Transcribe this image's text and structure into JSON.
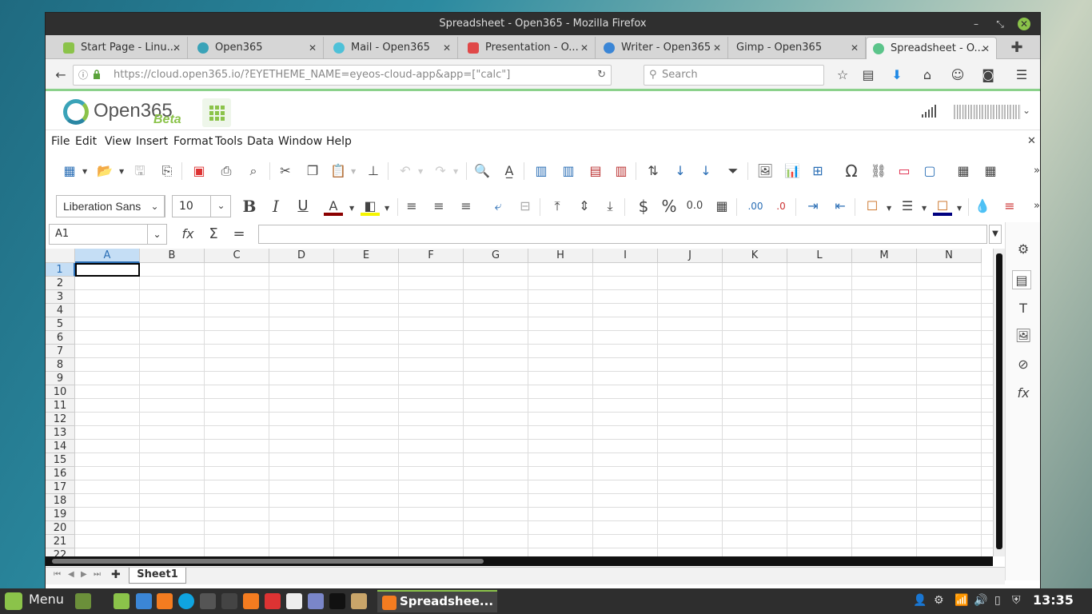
{
  "window": {
    "title": "Spreadsheet - Open365 - Mozilla Firefox",
    "controls": [
      "minimize-icon",
      "restore-icon",
      "close-icon"
    ]
  },
  "tabs": [
    {
      "label": "Start Page - Linu...",
      "favicon_color": "#8bc34a",
      "active": false
    },
    {
      "label": "Open365",
      "favicon_color": "#3aa3b8",
      "active": false
    },
    {
      "label": "Mail - Open365",
      "favicon_color": "#4ec1d8",
      "active": false
    },
    {
      "label": "Presentation - O...",
      "favicon_color": "#e04848",
      "active": false
    },
    {
      "label": "Writer - Open365",
      "favicon_color": "#3b86d6",
      "active": false
    },
    {
      "label": "Gimp - Open365",
      "favicon_color": "",
      "active": false
    },
    {
      "label": "Spreadsheet - O...",
      "favicon_color": "#5bc48a",
      "active": true
    }
  ],
  "navbar": {
    "url": "https://cloud.open365.io/?EYETHEME_NAME=eyeos-cloud-app&app=[\"calc\"]",
    "search_placeholder": "Search"
  },
  "app": {
    "logo_text": "Open365",
    "logo_badge": "Beta",
    "brand_color": "#8bc34a"
  },
  "menu": [
    "File",
    "Edit",
    "View",
    "Insert",
    "Format",
    "Tools",
    "Data",
    "Window",
    "Help"
  ],
  "format_bar": {
    "font_name": "Liberation Sans",
    "font_size": "10",
    "bold": "B",
    "italic": "I",
    "underline": "U",
    "currency": "$",
    "percent": "%",
    "number": "0.0"
  },
  "formula_bar": {
    "cell_ref": "A1",
    "function_wizard": "fx",
    "sum": "Σ",
    "equals": "=",
    "content": ""
  },
  "grid": {
    "columns": [
      "A",
      "B",
      "C",
      "D",
      "E",
      "F",
      "G",
      "H",
      "I",
      "J",
      "K",
      "L",
      "M",
      "N"
    ],
    "rows": [
      "1",
      "2",
      "3",
      "4",
      "5",
      "6",
      "7",
      "8",
      "9",
      "10",
      "11",
      "12",
      "13",
      "14",
      "15",
      "16",
      "17",
      "18",
      "19",
      "20",
      "21",
      "22"
    ],
    "selected_column": "A",
    "selected_row": "1"
  },
  "sheets": [
    "Sheet1"
  ],
  "taskbar": {
    "menu_label": "Menu",
    "active_window": "Spreadshee...",
    "clock": "13:35"
  }
}
